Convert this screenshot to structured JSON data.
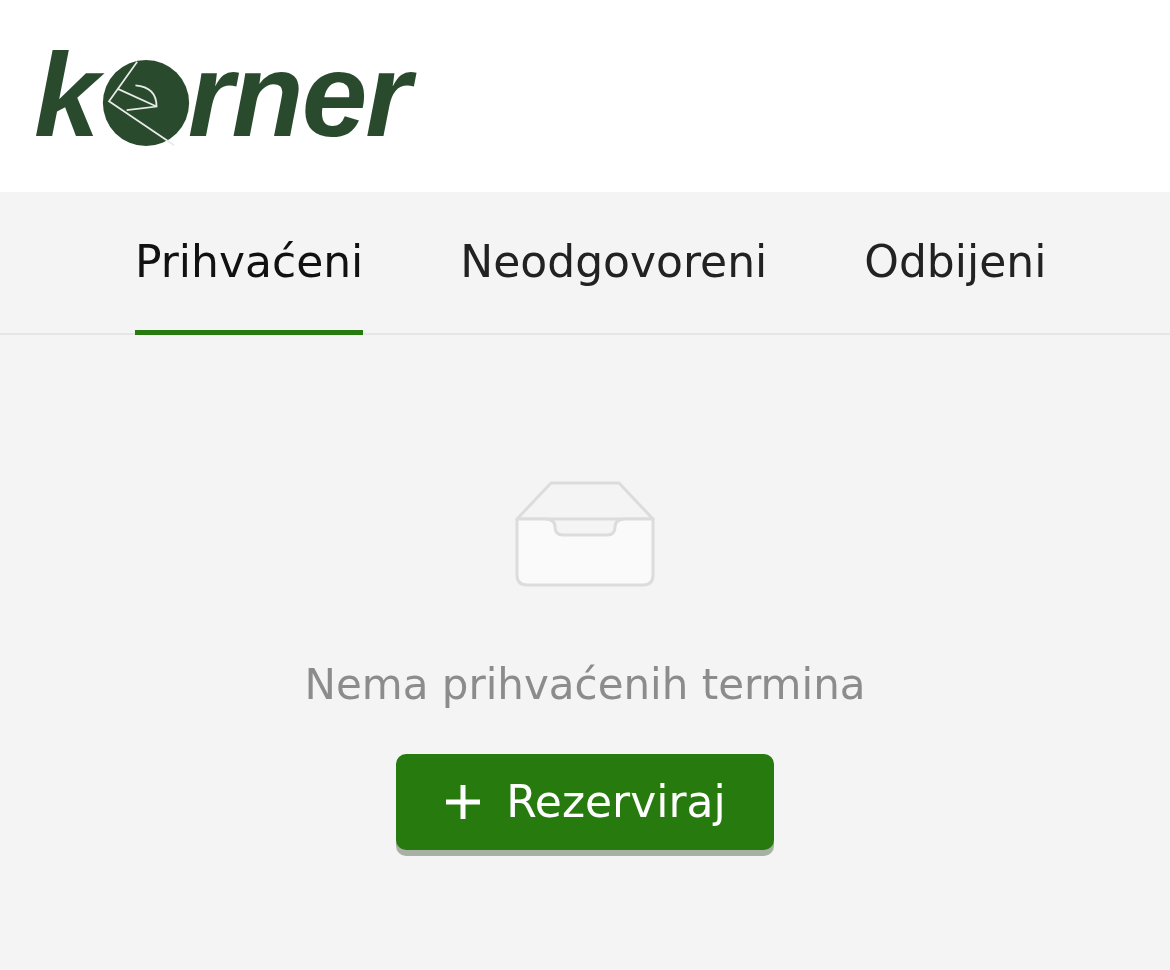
{
  "logo": {
    "first": "k",
    "rest": "rner"
  },
  "tabs": [
    {
      "label": "Prihvaćeni",
      "selected": true
    },
    {
      "label": "Neodgovoreni",
      "selected": false
    },
    {
      "label": "Odbijeni",
      "selected": false
    }
  ],
  "empty_state": {
    "message": "Nema prihvaćenih termina",
    "button": "Rezerviraj"
  }
}
